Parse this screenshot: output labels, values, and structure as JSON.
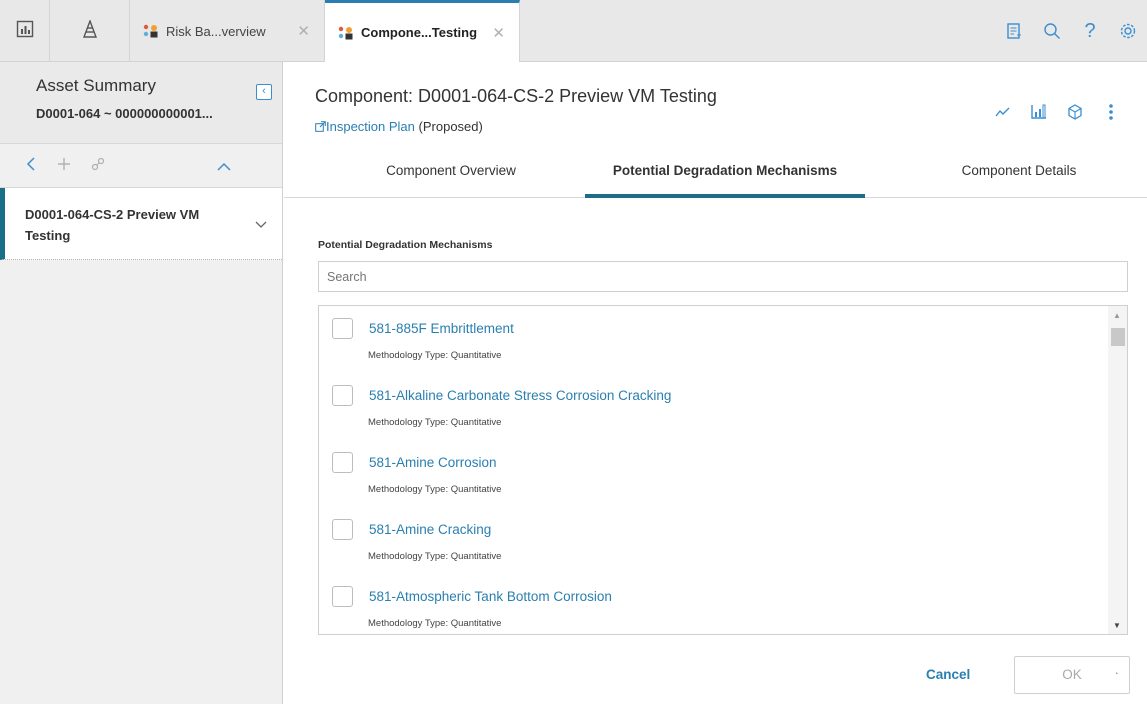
{
  "tabs": {
    "home_icon": "dashboard-icon",
    "asset_icon": "asset-hierarchy-icon",
    "tab1_label": "Risk Ba...verview",
    "tab2_label": "Compone...Testing"
  },
  "top_actions": [
    "clipboard-icon",
    "search-icon",
    "help-icon",
    "settings-icon"
  ],
  "left": {
    "title": "Asset Summary",
    "subtitle": "D0001-064 ~ 000000000001...",
    "tree_item": "D0001-064-CS-2 Preview VM Testing"
  },
  "main": {
    "title": "Component: D0001-064-CS-2 Preview VM Testing",
    "inspection_link": "Inspection Plan",
    "inspection_status": "(Proposed)",
    "tabs": [
      {
        "label": "Component Overview"
      },
      {
        "label": "Potential Degradation Mechanisms"
      },
      {
        "label": "Component Details"
      }
    ],
    "section_label": "Potential Degradation Mechanisms",
    "search_placeholder": "Search",
    "items": [
      {
        "name": "581-885F Embrittlement",
        "meta": "Methodology Type: Quantitative"
      },
      {
        "name": "581-Alkaline Carbonate Stress Corrosion Cracking",
        "meta": "Methodology Type: Quantitative"
      },
      {
        "name": "581-Amine Corrosion",
        "meta": "Methodology Type: Quantitative"
      },
      {
        "name": "581-Amine Cracking",
        "meta": "Methodology Type: Quantitative"
      },
      {
        "name": "581-Atmospheric Tank Bottom Corrosion",
        "meta": "Methodology Type: Quantitative"
      }
    ],
    "cancel": "Cancel",
    "ok": "OK"
  },
  "colors": {
    "accent": "#2a7fb0",
    "active_tab": "#1a6f87"
  }
}
